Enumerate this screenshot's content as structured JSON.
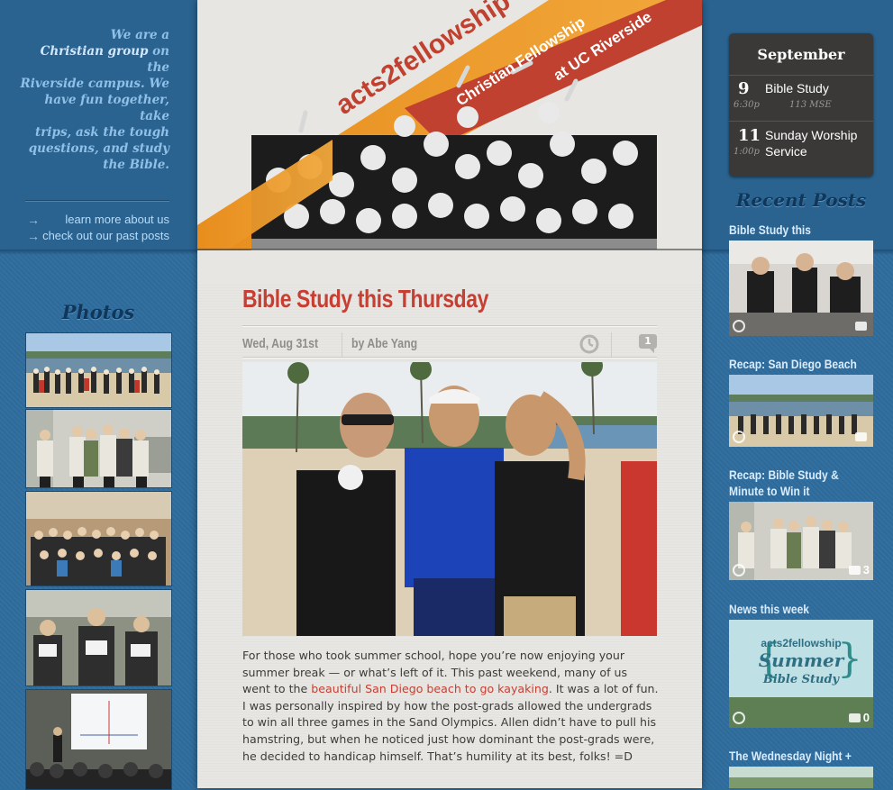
{
  "sidebar_left": {
    "intro_lines": [
      "We are a",
      "Christian group",
      "on the",
      "Riverside campus. We",
      "have fun together, take",
      "trips, ask the tough",
      "questions, and study",
      "the Bible."
    ],
    "links": [
      {
        "label": "learn more about us",
        "icon": "arrow-right-icon"
      },
      {
        "label": "check out our past posts",
        "icon": "arrow-right-icon"
      }
    ],
    "photos_heading": "Photos"
  },
  "banner": {
    "logo": "acts2fellowship",
    "tagline_1": "Christian Fellowship",
    "tagline_2": "at UC Riverside"
  },
  "post": {
    "title": "Bible Study this Thursday",
    "date": "Wed, Aug 31st",
    "author": "by Abe Yang",
    "comment_count": "1",
    "body_before_link": "For those who took summer school, hope you’re now enjoying your summer break — or what’s left of it. This past weekend, many of us went to the ",
    "body_link": "beautiful San Diego beach to go kayaking",
    "body_after_link": ". It was a lot of fun. I was personally inspired by how the post-grads allowed the undergrads to win all three games in the Sand Olympics. Allen didn’t have to pull his hamstring, but when he noticed just how dominant the post-grads were, he decided to handicap himself. That’s humility at its best, folks! =D"
  },
  "calendar": {
    "month": "September",
    "events": [
      {
        "day": "9",
        "time": "6:30p",
        "name": "Bible Study",
        "location": "113 MSE"
      },
      {
        "day": "11",
        "time": "1:00p",
        "name_line1": "Sunday Worship",
        "name_line2": "Service"
      }
    ]
  },
  "recent": {
    "heading": "Recent Posts",
    "posts": [
      {
        "title": "Bible Study this Thursday",
        "comments": ""
      },
      {
        "title": "Recap: San Diego Beach Trip!",
        "comments": ""
      },
      {
        "title": "Recap: Bible Study & Minute to Win it",
        "comments": "3"
      },
      {
        "title": "News this week",
        "comments": "0",
        "img_line1": "acts2fellowship",
        "img_line2": "Summer",
        "img_line3": "Bible Study"
      },
      {
        "title": "The Wednesday Night + SWS",
        "comments": ""
      }
    ]
  },
  "colors": {
    "accent_red": "#c63f32",
    "banner_orange": "#e68a1e",
    "page_blue": "#2f6d9d"
  }
}
